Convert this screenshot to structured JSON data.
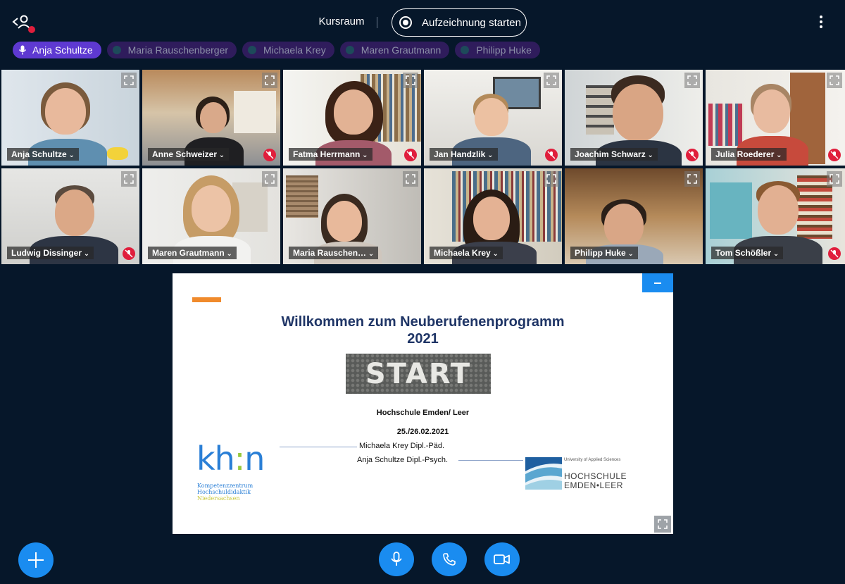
{
  "header": {
    "room_title": "Kursraum",
    "record_label": "Aufzeichnung starten"
  },
  "talkers": [
    {
      "name": "Anja Schultze",
      "state": "talking"
    },
    {
      "name": "Maria Rauschenberger",
      "state": "idle"
    },
    {
      "name": "Michaela Krey",
      "state": "idle"
    },
    {
      "name": "Maren Grautmann",
      "state": "idle"
    },
    {
      "name": "Philipp Huke",
      "state": "idle"
    }
  ],
  "videos": [
    {
      "name": "Anja Schultze",
      "muted": false,
      "active": true
    },
    {
      "name": "Anne Schweizer",
      "muted": true
    },
    {
      "name": "Fatma Herrmann",
      "muted": true
    },
    {
      "name": "Jan Handzlik",
      "muted": true
    },
    {
      "name": "Joachim Schwarz",
      "muted": true
    },
    {
      "name": "Julia Roederer",
      "muted": true
    },
    {
      "name": "Ludwig Dissinger",
      "muted": true
    },
    {
      "name": "Maren Grautmann",
      "muted": false
    },
    {
      "name": "Maria Rauschen…",
      "muted": false
    },
    {
      "name": "Michaela Krey",
      "muted": false
    },
    {
      "name": "Philipp Huke",
      "muted": false
    },
    {
      "name": "Tom Schößler",
      "muted": true
    }
  ],
  "slide": {
    "title_line1": "Willkommen zum Neuberufenenprogramm",
    "title_line2": "2021",
    "image_text": "START",
    "university": "Hochschule Emden/ Leer",
    "date": "25./26.02.2021",
    "presenter1": "Michaela Krey Dipl.-Päd.",
    "presenter2": "Anja Schultze Dipl.-Psych.",
    "khn_logo_text": "kh:n",
    "khn_sub_line1": "Kompetenzzentrum",
    "khn_sub_line2": "Hochschuldidaktik",
    "khn_sub_line3": "Niedersachsen",
    "hs_small": "University of Applied Sciences",
    "hs_line1": "HOCHSCHULE",
    "hs_line2": "EMDEN•LEER"
  },
  "colors": {
    "background": "#06172A",
    "accent": "#1A8CF0",
    "talker_active": "#5E39D1",
    "talker_idle": "#2F1C5C",
    "muted_badge": "#E01E3C",
    "slide_title": "#1F3566",
    "slide_accent_bar": "#F08A2C"
  },
  "icons": {
    "users": "users-icon",
    "record": "record-icon",
    "more": "more-vertical-icon",
    "fullscreen": "fullscreen-icon",
    "muted": "mic-off-icon",
    "add": "plus-icon",
    "mic": "microphone-icon",
    "phone": "phone-icon",
    "video": "video-camera-icon"
  }
}
